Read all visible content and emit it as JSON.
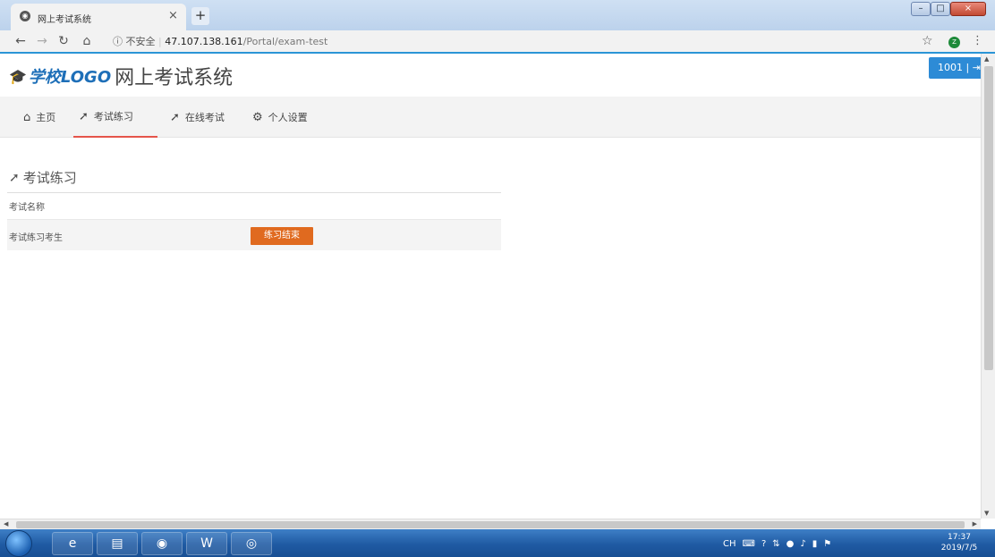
{
  "browser": {
    "tab_title": "网上考试系统",
    "tab_close": "×",
    "new_tab": "+",
    "insecure_label": "ⓘ 不安全",
    "url_host": "47.107.138.161",
    "url_path": "/Portal/exam-test",
    "profile_initial": "Z"
  },
  "header": {
    "logo_school": "学校LOGO",
    "system_title": "网上考试系统",
    "user_badge": "1001 | ⇥"
  },
  "nav": {
    "items": [
      {
        "label": "主页",
        "icon": "home-icon"
      },
      {
        "label": "考试练习",
        "icon": "paper-plane-icon"
      },
      {
        "label": "在线考试",
        "icon": "paper-plane-icon"
      },
      {
        "label": "个人设置",
        "icon": "gears-icon"
      }
    ],
    "active_index": 1
  },
  "main": {
    "section_title": "考试练习",
    "table": {
      "header": "考试名称",
      "rows": [
        {
          "name": "考试练习考生",
          "action": "练习结束"
        }
      ]
    }
  },
  "taskbar": {
    "tray_lang": "CH",
    "time": "17:37",
    "date": "2019/7/5"
  },
  "colors": {
    "accent_blue": "#2d8bd6",
    "action_orange": "#e06a1f",
    "active_underline": "#e4544a"
  }
}
